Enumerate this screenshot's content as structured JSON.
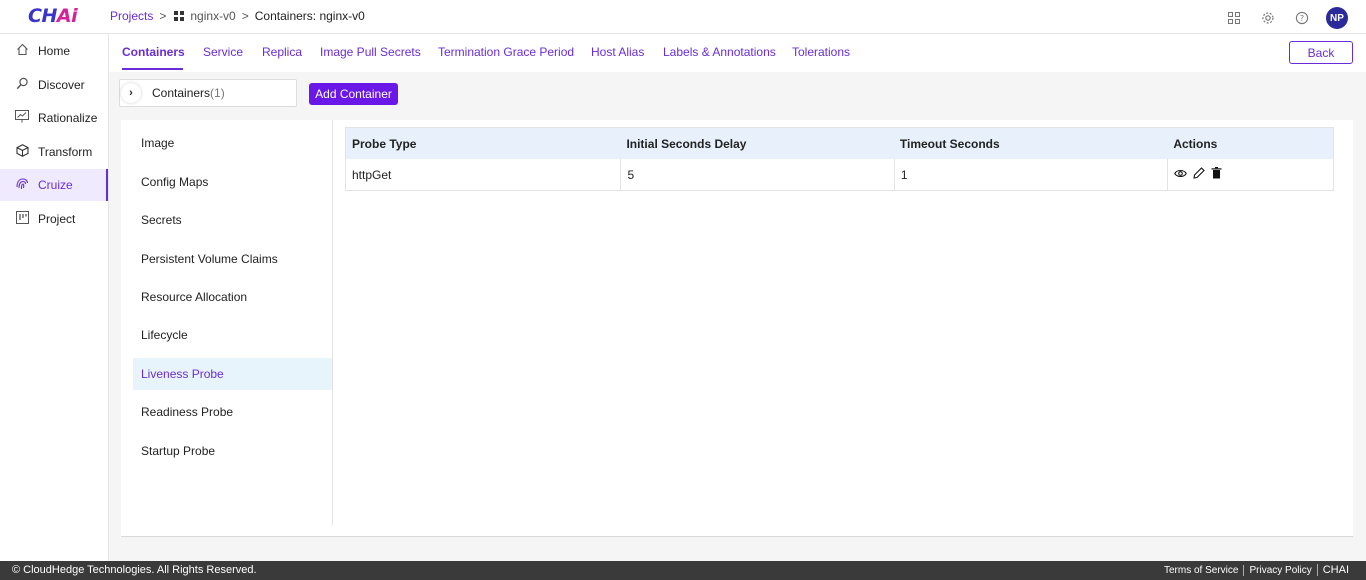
{
  "brand": {
    "logo_main": "CH",
    "logo_accent": "Ai"
  },
  "breadcrumb": {
    "projects": "Projects",
    "sep1": ">",
    "project": "nginx-v0",
    "sep2": ">",
    "current": "Containers: nginx-v0"
  },
  "user": {
    "initials": "NP"
  },
  "sidebar": {
    "items": [
      {
        "label": "Home",
        "icon": "home-icon"
      },
      {
        "label": "Discover",
        "icon": "magnifier-icon"
      },
      {
        "label": "Rationalize",
        "icon": "chart-icon"
      },
      {
        "label": "Transform",
        "icon": "cube-icon"
      },
      {
        "label": "Cruize",
        "icon": "fingerprint-icon"
      },
      {
        "label": "Project",
        "icon": "board-icon"
      }
    ]
  },
  "tabs": [
    "Containers",
    "Service",
    "Replica",
    "Image Pull Secrets",
    "Termination Grace Period",
    "Host Alias",
    "Labels & Annotations",
    "Tolerations"
  ],
  "back_label": "Back",
  "container_selector": {
    "label": "Containers",
    "count": "(1)"
  },
  "add_container_label": "Add Container",
  "left_menu": [
    "Image",
    "Config Maps",
    "Secrets",
    "Persistent Volume Claims",
    "Resource Allocation",
    "Lifecycle",
    "Liveness Probe",
    "Readiness Probe",
    "Startup Probe"
  ],
  "table": {
    "headers": [
      "Probe Type",
      "Initial Seconds Delay",
      "Timeout Seconds",
      "Actions"
    ],
    "rows": [
      {
        "probe_type": "httpGet",
        "initial_delay": "5",
        "timeout": "1"
      }
    ]
  },
  "footer": {
    "copyright": "© CloudHedge Technologies. All Rights Reserved.",
    "terms": "Terms of Service",
    "privacy": "Privacy Policy",
    "brand": "CHAI"
  },
  "colors": {
    "accent": "#6a2cd8",
    "button": "#6a18e8",
    "footer": "#3a3a3a"
  }
}
